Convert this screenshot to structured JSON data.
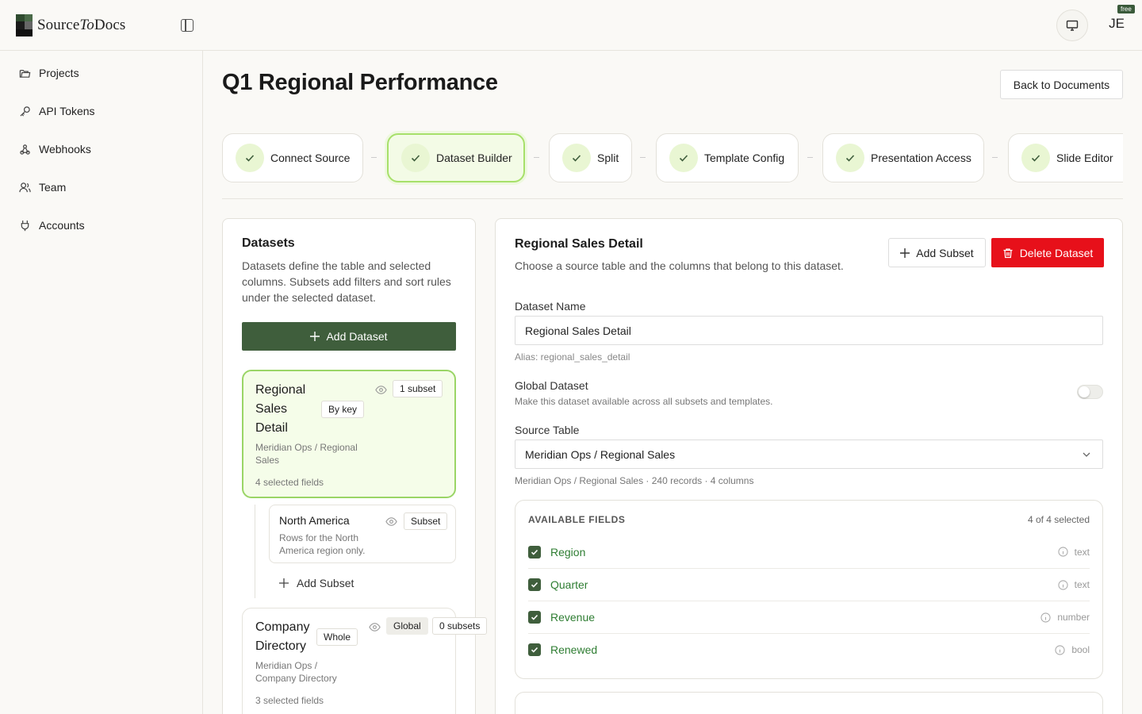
{
  "app": {
    "brand_main": "Source",
    "brand_italic": "To",
    "brand_tail": "Docs",
    "avatar_initials": "JE",
    "plan_badge": "free"
  },
  "sidebar": {
    "items": [
      {
        "label": "Projects",
        "icon": "folder-icon"
      },
      {
        "label": "API Tokens",
        "icon": "key-icon"
      },
      {
        "label": "Webhooks",
        "icon": "webhook-icon"
      },
      {
        "label": "Team",
        "icon": "users-icon"
      },
      {
        "label": "Accounts",
        "icon": "plug-icon"
      }
    ]
  },
  "header": {
    "title": "Q1 Regional Performance",
    "back_label": "Back to Documents"
  },
  "steps": [
    {
      "label": "Connect Source",
      "state": "done"
    },
    {
      "label": "Dataset Builder",
      "state": "active"
    },
    {
      "label": "Split",
      "state": "done"
    },
    {
      "label": "Template Config",
      "state": "done"
    },
    {
      "label": "Presentation Access",
      "state": "done"
    },
    {
      "label": "Slide Editor",
      "state": "done"
    }
  ],
  "datasets_panel": {
    "title": "Datasets",
    "description": "Datasets define the table and selected columns. Subsets add filters and sort rules under the selected dataset.",
    "add_label": "Add Dataset",
    "datasets": [
      {
        "name": "Regional Sales Detail",
        "key_chip": "By key",
        "count_chip": "1 subset",
        "source": "Meridian Ops / Regional Sales",
        "fields": "4 selected fields"
      },
      {
        "name": "Company Directory",
        "key_chip": "Whole",
        "global_chip": "Global",
        "count_chip": "0 subsets",
        "source": "Meridian Ops / Company Directory",
        "fields": "3 selected fields"
      }
    ],
    "subset": {
      "name": "North America",
      "chip": "Subset",
      "description": "Rows for the North America region only."
    },
    "add_subset_label": "Add Subset"
  },
  "detail": {
    "title": "Regional Sales Detail",
    "subtitle": "Choose a source table and the columns that belong to this dataset.",
    "add_subset_label": "Add Subset",
    "delete_label": "Delete Dataset",
    "name_label": "Dataset Name",
    "name_value": "Regional Sales Detail",
    "alias": "Alias: regional_sales_detail",
    "global_label": "Global Dataset",
    "global_desc": "Make this dataset available across all subsets and templates.",
    "global_enabled": false,
    "source_label": "Source Table",
    "source_value": "Meridian Ops / Regional Sales",
    "source_meta": "Meridian Ops / Regional Sales · 240 records · 4 columns",
    "fields_heading": "AVAILABLE FIELDS",
    "fields_count": "4 of 4 selected",
    "fields": [
      {
        "name": "Region",
        "type": "text"
      },
      {
        "name": "Quarter",
        "type": "text"
      },
      {
        "name": "Revenue",
        "type": "number"
      },
      {
        "name": "Renewed",
        "type": "bool"
      }
    ]
  },
  "colors": {
    "primary": "#3f5e3c",
    "accent_green": "#9ad566",
    "danger": "#e7101a",
    "field_text": "#2e7d32"
  }
}
